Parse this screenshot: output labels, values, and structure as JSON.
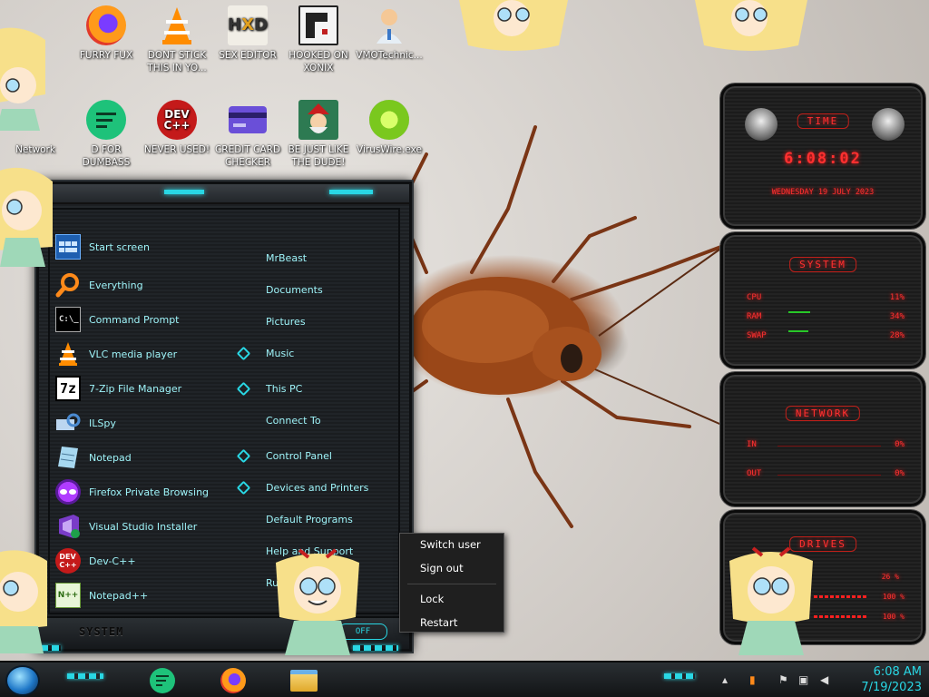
{
  "desktop_icons": [
    {
      "label": "FURRY FUX",
      "icon": "firefox-icon"
    },
    {
      "label": "DONT STICK THIS IN YO...",
      "icon": "vlc-icon"
    },
    {
      "label": "SEX EDITOR",
      "icon": "hxd-icon"
    },
    {
      "label": "HOOKED ON XONIX",
      "icon": "xonix-icon"
    },
    {
      "label": "VMOTechnic...",
      "icon": "doctor-icon"
    },
    {
      "label": "Network",
      "icon": "network-icon"
    },
    {
      "label": "D FOR DUMBASS",
      "icon": "d-icon"
    },
    {
      "label": "NEVER USED!",
      "icon": "devcpp-icon"
    },
    {
      "label": "CREDIT CARD CHECKER",
      "icon": "credit-card-icon"
    },
    {
      "label": "BE JUST LIKE THE DUDE!",
      "icon": "elf-icon"
    },
    {
      "label": "VirusWire.exe",
      "icon": "lime-icon"
    }
  ],
  "start_menu": {
    "left_items": [
      {
        "label": "Start screen",
        "icon": "start-screen-icon"
      },
      {
        "label": "Everything",
        "icon": "search-icon"
      },
      {
        "label": "Command Prompt",
        "icon": "command-prompt-icon"
      },
      {
        "label": "VLC media player",
        "icon": "vlc-icon"
      },
      {
        "label": "7-Zip File Manager",
        "icon": "7zip-icon"
      },
      {
        "label": "ILSpy",
        "icon": "ilspy-icon"
      },
      {
        "label": "Notepad",
        "icon": "notepad-icon"
      },
      {
        "label": "Firefox Private Browsing",
        "icon": "firefox-private-icon"
      },
      {
        "label": "Visual Studio Installer",
        "icon": "visual-studio-icon"
      },
      {
        "label": "Dev-C++",
        "icon": "devcpp-icon"
      },
      {
        "label": "Notepad++",
        "icon": "notepadpp-icon"
      }
    ],
    "right_items": [
      {
        "label": "MrBeast",
        "arrow": false
      },
      {
        "label": "Documents",
        "arrow": false
      },
      {
        "label": "Pictures",
        "arrow": false
      },
      {
        "label": "Music",
        "arrow": true
      },
      {
        "label": "This PC",
        "arrow": true
      },
      {
        "label": "Connect To",
        "arrow": false
      },
      {
        "label": "Control Panel",
        "arrow": true
      },
      {
        "label": "Devices and Printers",
        "arrow": true
      },
      {
        "label": "Default Programs",
        "arrow": false
      },
      {
        "label": "Help and Support",
        "arrow": false
      },
      {
        "label": "Run...",
        "arrow": false
      }
    ],
    "system_label": "SYSTEM",
    "off_label": "OFF"
  },
  "power_menu": {
    "items": [
      "Switch user",
      "Sign out",
      "Lock",
      "Restart"
    ]
  },
  "widgets": {
    "time": {
      "title": "TIME",
      "clock": "6:08:02",
      "date": "WEDNESDAY 19 JULY 2023"
    },
    "system": {
      "title": "SYSTEM",
      "rows": [
        {
          "label": "CPU",
          "value": "11%"
        },
        {
          "label": "RAM",
          "value": "34%"
        },
        {
          "label": "SWAP",
          "value": "28%"
        }
      ]
    },
    "network": {
      "title": "NETWORK",
      "rows": [
        {
          "label": "IN",
          "value": "0%"
        },
        {
          "label": "OUT",
          "value": "0%"
        }
      ]
    },
    "drives": {
      "title": "DRIVES",
      "values": [
        "26 %",
        "100 %",
        "100 %"
      ]
    }
  },
  "taskbar": {
    "time": "6:08 AM",
    "date": "7/19/2023",
    "apps": [
      "d-icon",
      "firefox-icon",
      "file-explorer-icon"
    ]
  },
  "colors": {
    "accent_cyan": "#29d7e4",
    "accent_red": "#ff3030"
  }
}
